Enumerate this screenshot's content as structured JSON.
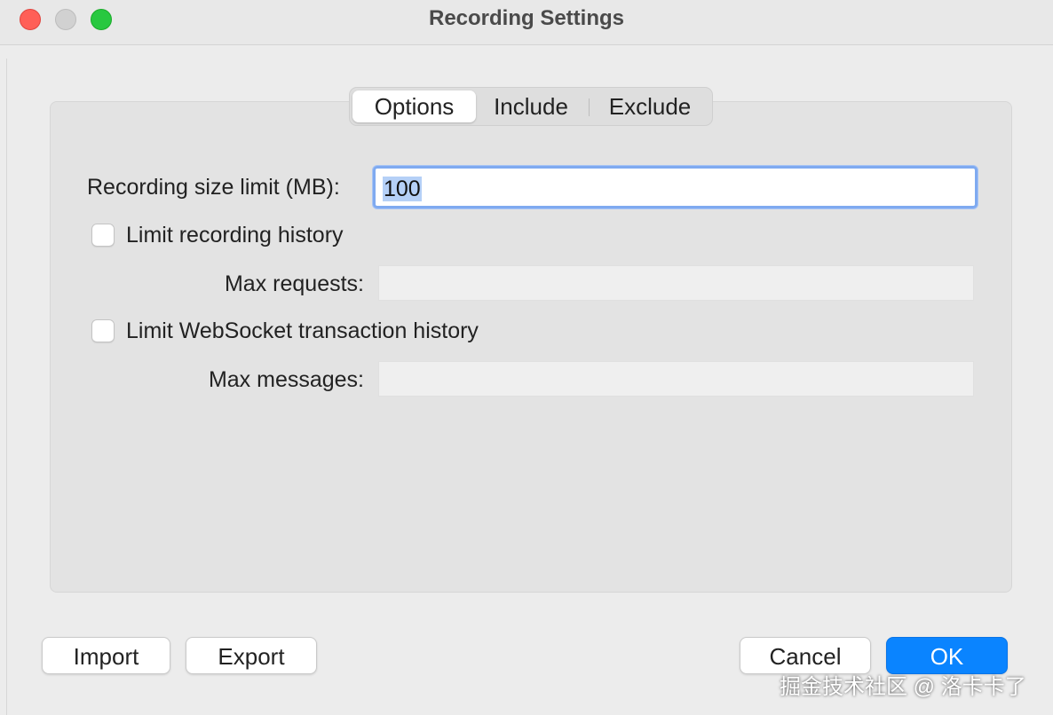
{
  "window": {
    "title": "Recording Settings"
  },
  "tabs": [
    {
      "label": "Options",
      "active": true
    },
    {
      "label": "Include",
      "active": false
    },
    {
      "label": "Exclude",
      "active": false
    }
  ],
  "options": {
    "size_limit_label": "Recording size limit (MB):",
    "size_limit_value": "100",
    "limit_history_label": "Limit recording history",
    "limit_history_checked": false,
    "max_requests_label": "Max requests:",
    "max_requests_value": "",
    "limit_ws_label": "Limit WebSocket transaction history",
    "limit_ws_checked": false,
    "max_messages_label": "Max messages:",
    "max_messages_value": ""
  },
  "buttons": {
    "import": "Import",
    "export": "Export",
    "cancel": "Cancel",
    "ok": "OK"
  },
  "watermark": "掘金技术社区 @ 洛卡卡了",
  "colors": {
    "accent": "#0a84ff",
    "focus_ring": "#7faaf0",
    "selection": "#b5d0f7",
    "close": "#ff5f57",
    "maximize": "#28c840"
  }
}
